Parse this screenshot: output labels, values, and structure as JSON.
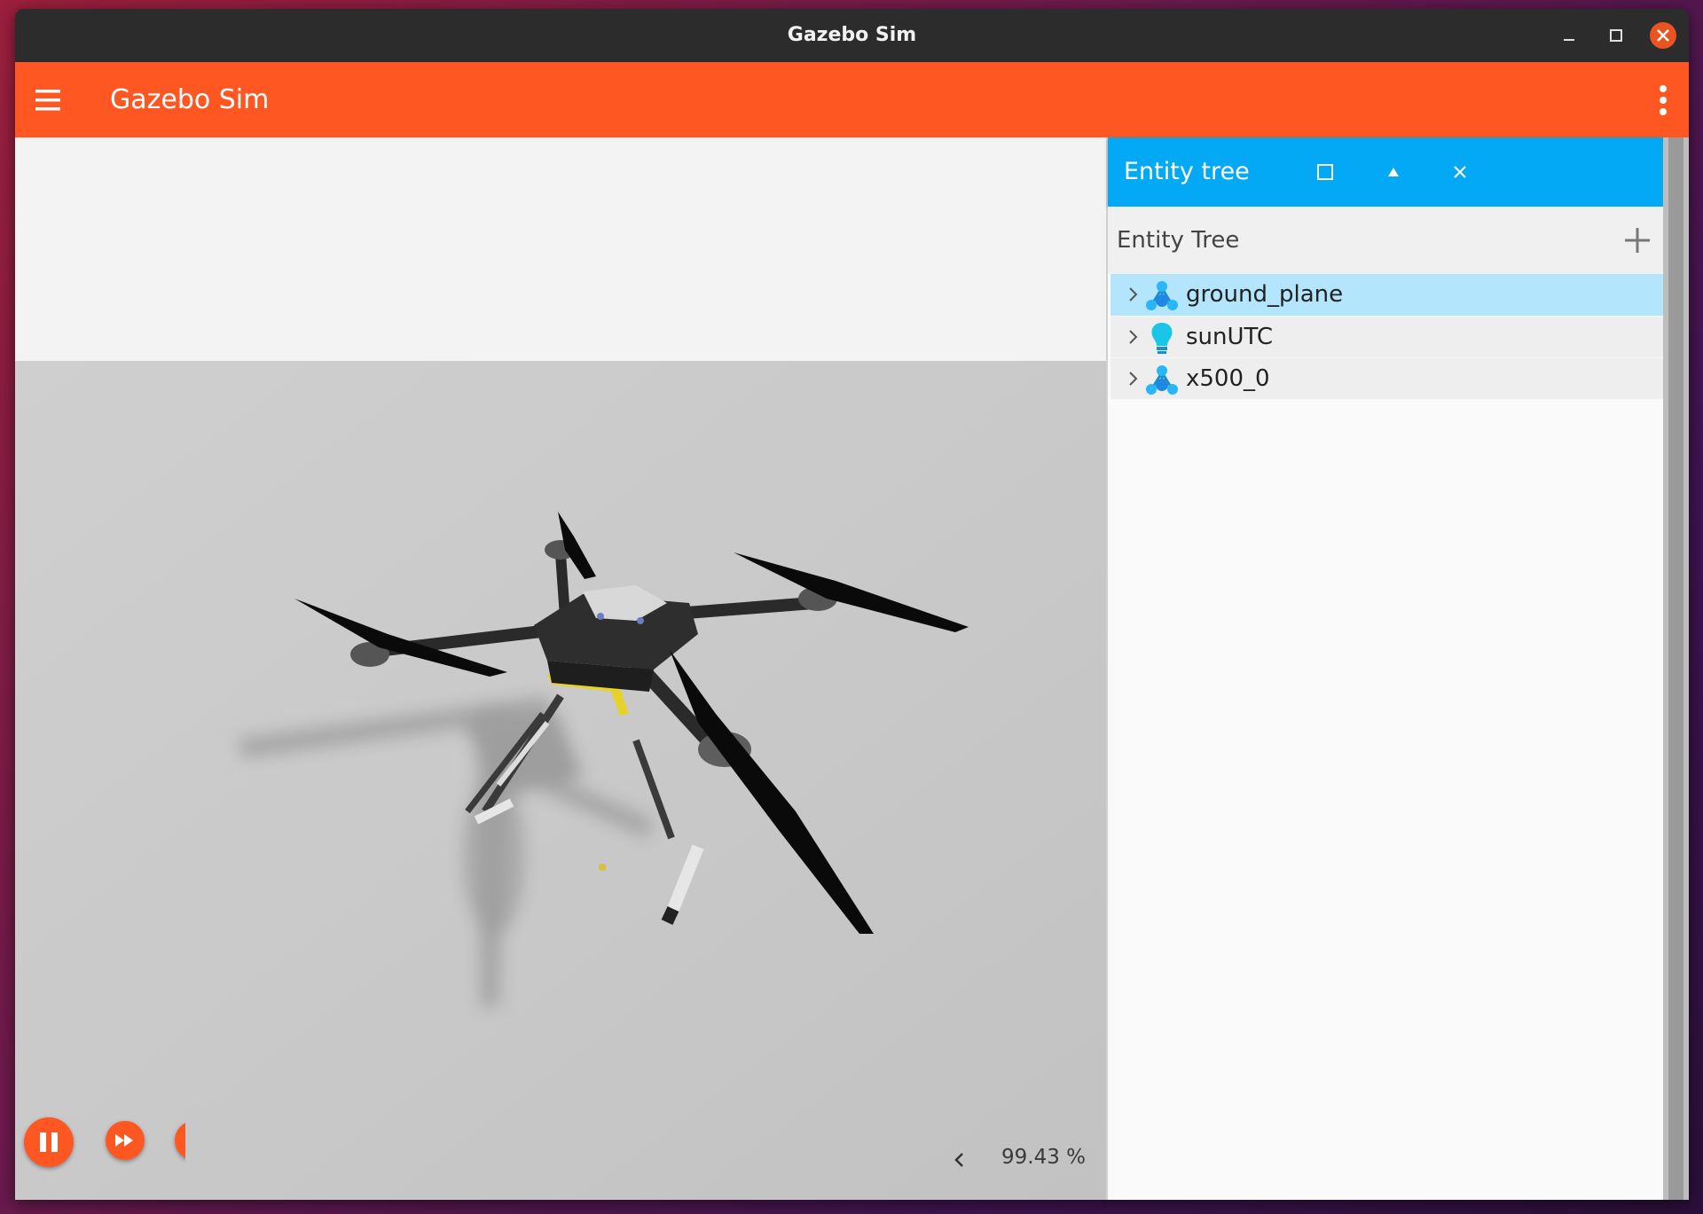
{
  "window": {
    "title": "Gazebo Sim",
    "controls": [
      "minimize-icon",
      "maximize-icon",
      "close-icon"
    ],
    "close_color": "#e95420"
  },
  "app_bar": {
    "title": "Gazebo Sim",
    "color": "#fe5722",
    "menu_icon": "hamburger-menu-icon",
    "overflow_icon": "vertical-dots-icon"
  },
  "viewport": {
    "controls": {
      "play_pause_icon": "pause-icon",
      "step_icon": "fast-forward-icon"
    },
    "rtf": {
      "collapse_icon": "chevron-left-icon",
      "value": "99.43 %"
    }
  },
  "panel": {
    "title": "Entity tree",
    "header_color": "#03a9f4",
    "header_controls": [
      "dock-icon",
      "collapse-icon",
      "close-icon"
    ],
    "tree_title": "Entity Tree",
    "add_icon": "plus-icon",
    "entities": [
      {
        "label": "ground_plane",
        "icon": "model-icon",
        "selected": true
      },
      {
        "label": "sunUTC",
        "icon": "light-bulb-icon",
        "selected": false
      },
      {
        "label": "x500_0",
        "icon": "model-icon",
        "selected": false
      }
    ],
    "selected_color": "#b3e5fc"
  }
}
